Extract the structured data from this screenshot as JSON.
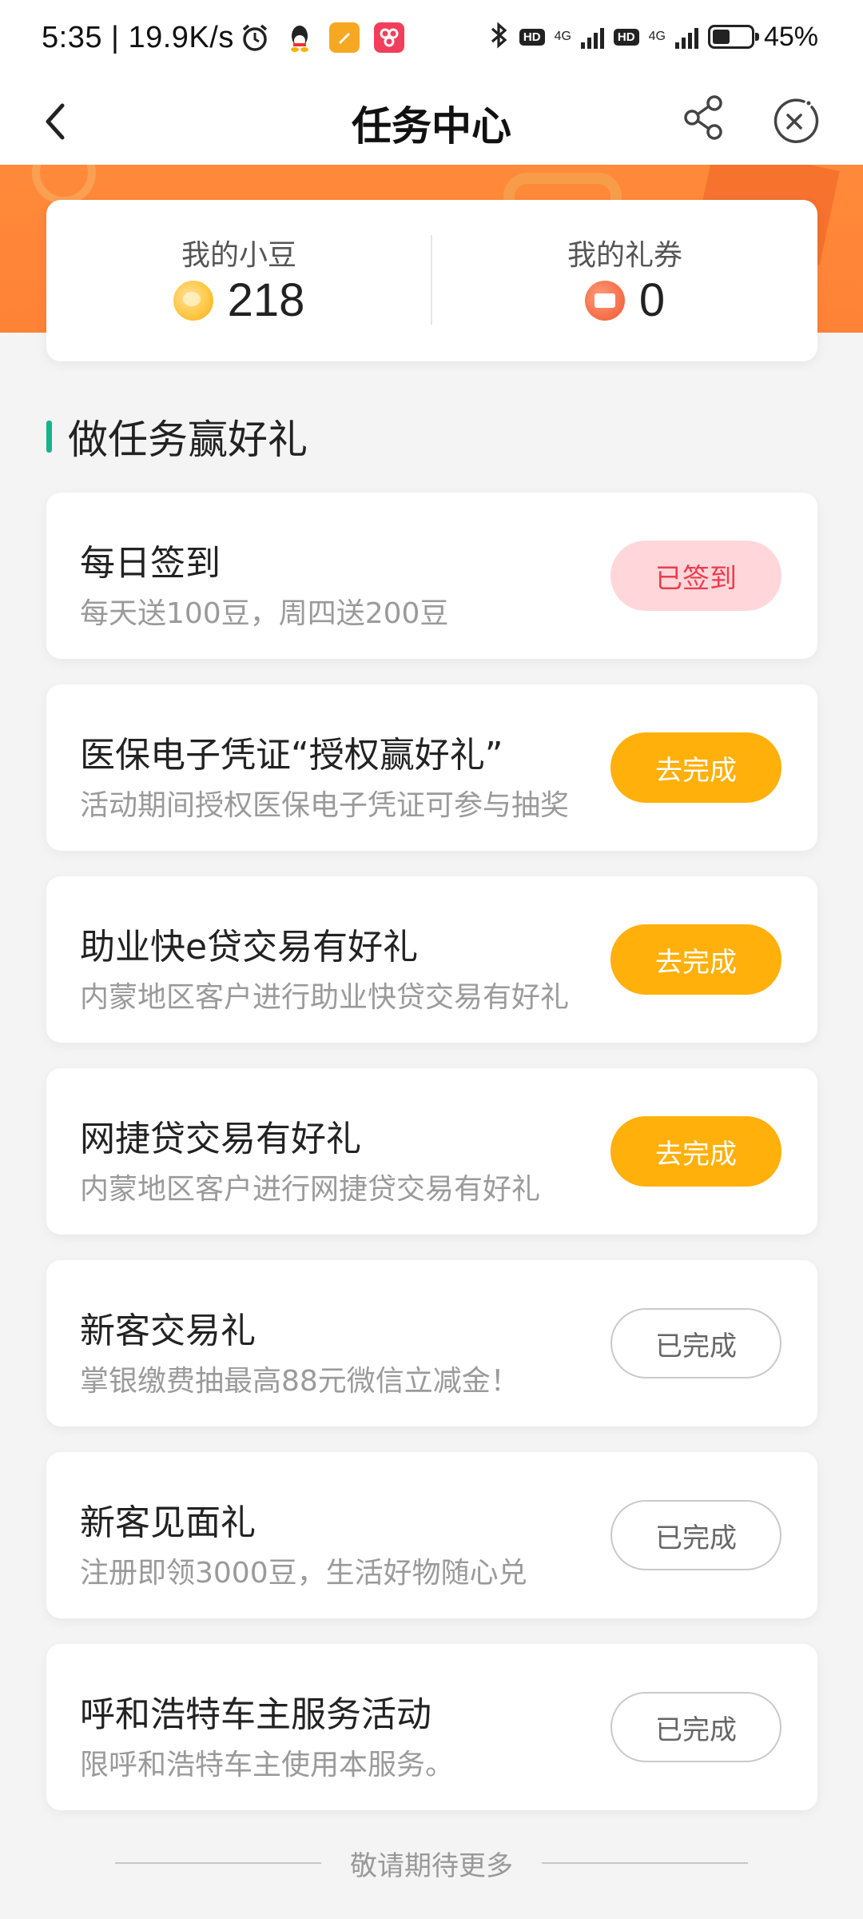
{
  "status_bar": {
    "time": "5:35",
    "speed": "19.9K/s",
    "network_1": "4G",
    "network_2": "4G",
    "hd_label": "HD",
    "battery_percent": "45%",
    "battery_level": 0.45,
    "icons": [
      "alarm-icon",
      "qq-icon",
      "notes-app-icon",
      "app-icon",
      "bluetooth-icon",
      "signal-icon",
      "battery-icon"
    ]
  },
  "nav": {
    "title": "任务中心",
    "back_icon": "chevron-left-icon",
    "share_icon": "share-icon",
    "close_icon": "close-circle-icon"
  },
  "summary": {
    "beans_label": "我的小豆",
    "beans_value": "218",
    "coupons_label": "我的礼券",
    "coupons_value": "0"
  },
  "section": {
    "title": "做任务赢好礼",
    "accent_color": "#14b58c"
  },
  "tasks": [
    {
      "title": "每日签到",
      "desc": "每天送100豆，周四送200豆",
      "button": "已签到",
      "state": "signed"
    },
    {
      "title": "医保电子凭证“授权赢好礼”",
      "desc": "活动期间授权医保电子凭证可参与抽奖",
      "button": "去完成",
      "state": "todo"
    },
    {
      "title": "助业快e贷交易有好礼",
      "desc": "内蒙地区客户进行助业快贷交易有好礼",
      "button": "去完成",
      "state": "todo"
    },
    {
      "title": "网捷贷交易有好礼",
      "desc": "内蒙地区客户进行网捷贷交易有好礼",
      "button": "去完成",
      "state": "todo"
    },
    {
      "title": "新客交易礼",
      "desc": "掌银缴费抽最高88元微信立减金！",
      "button": "已完成",
      "state": "done"
    },
    {
      "title": "新客见面礼",
      "desc": "注册即领3000豆，生活好物随心兑",
      "button": "已完成",
      "state": "done"
    },
    {
      "title": "呼和浩特车主服务活动",
      "desc": "限呼和浩特车主使用本服务。",
      "button": "已完成",
      "state": "done"
    }
  ],
  "footer": {
    "text": "敬请期待更多"
  },
  "colors": {
    "banner_orange": "#ff8a3a",
    "go_button": "#ffb00b",
    "signed_button_bg": "#ffd7da",
    "signed_button_text": "#ee3b4c"
  }
}
